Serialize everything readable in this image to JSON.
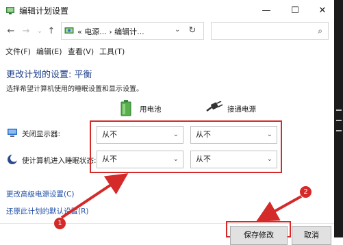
{
  "window": {
    "title": "编辑计划设置",
    "minimize_glyph": "—",
    "maximize_glyph": "☐",
    "close_glyph": "✕"
  },
  "nav": {
    "back": "←",
    "forward": "→",
    "recent": "⌄",
    "up": "↑",
    "address_path": "« 电源... › 编辑计...",
    "address_dropdown": "⌄",
    "refresh": "↻",
    "search_placeholder": "",
    "search_glyph": "⌕"
  },
  "menu": [
    {
      "label": "文件(F)"
    },
    {
      "label": "编辑(E)"
    },
    {
      "label": "查看(V)"
    },
    {
      "label": "工具(T)"
    }
  ],
  "content": {
    "heading": "更改计划的设置: 平衡",
    "description": "选择希望计算机使用的睡眠设置和显示设置。",
    "columns": {
      "battery": "用电池",
      "plugged": "接通电源"
    },
    "rows": [
      {
        "label": "关闭显示器:",
        "battery_value": "从不",
        "plugged_value": "从不"
      },
      {
        "label": "使计算机进入睡眠状态:",
        "battery_value": "从不",
        "plugged_value": "从不"
      }
    ],
    "links": {
      "advanced": "更改高级电源设置(C)",
      "restore": "还原此计划的默认设置(R)"
    }
  },
  "buttons": {
    "save": "保存修改",
    "cancel": "取消"
  },
  "annotations": {
    "badge1": "1",
    "badge2": "2",
    "color": "#d42a2a"
  }
}
